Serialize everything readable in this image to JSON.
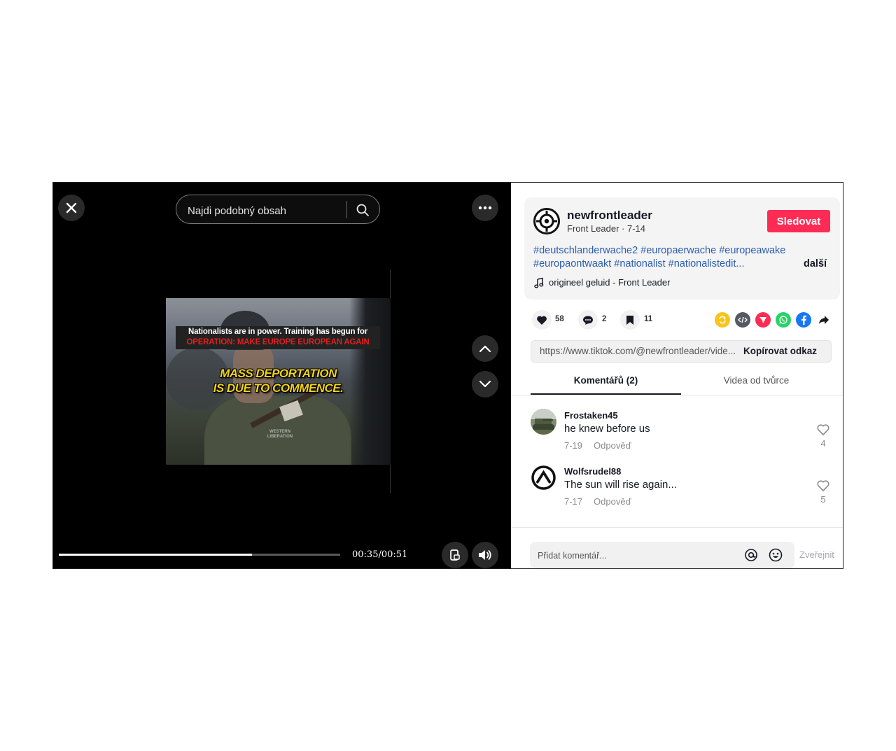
{
  "player": {
    "search_placeholder": "Najdi podobný obsah",
    "time": "00:35/00:51",
    "progress_fraction": 0.686,
    "video": {
      "banner_line1": "Nationalists are in power. Training has begun for",
      "banner_line2": "OPERATION: MAKE EUROPE EUROPEAN AGAIN",
      "headline_line1": "MASS DEPORTATION",
      "headline_line2": "IS DUE TO COMMENCE.",
      "watermark": "WESTERN LIBERATION"
    },
    "icons": {
      "close": "close-icon",
      "search": "search-icon",
      "more": "more-icon",
      "up": "chevron-up-icon",
      "down": "chevron-down-icon",
      "subtitles": "subtitles-icon",
      "volume": "volume-icon"
    }
  },
  "post": {
    "username": "newfrontleader",
    "subline": "Front Leader · 7-14",
    "follow_label": "Sledovat",
    "hashtags_line1": "#deutschlanderwache2 #europaerwache #europeawake",
    "hashtags_line2": "#europaontwaakt #nationalist #nationalistedit...",
    "more_label": "další",
    "music": "origineel geluid - Front Leader",
    "likes": "58",
    "comments": "2",
    "saves": "11",
    "link": "https://www.tiktok.com/@newfrontleader/vide...",
    "copy_label": "Kopírovat odkaz",
    "share_icons": [
      "repost-icon",
      "embed-icon",
      "send-icon",
      "whatsapp-icon",
      "facebook-icon",
      "share-arrow-icon"
    ]
  },
  "tabs": {
    "comments": "Komentářů (2)",
    "videos": "Videa od tvůrce"
  },
  "comments": [
    {
      "user": "Frostaken45",
      "text": "he knew before us",
      "date": "7-19",
      "reply": "Odpověď",
      "likes": "4"
    },
    {
      "user": "Wolfsrudel88",
      "text": "The sun will rise again...",
      "date": "7-17",
      "reply": "Odpověď",
      "likes": "5"
    }
  ],
  "composer": {
    "placeholder": "Přidat komentář...",
    "post_label": "Zveřejnit"
  },
  "colors": {
    "accent": "#fe2c55",
    "hashtag": "#2b5db0"
  }
}
